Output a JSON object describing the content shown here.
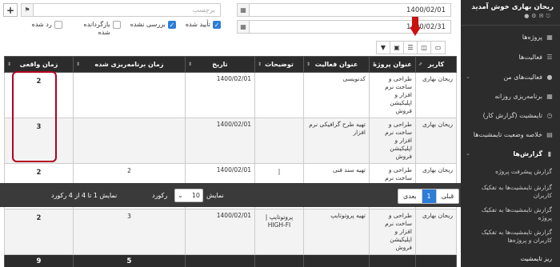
{
  "top": {
    "date_from": "1400/02/01",
    "date_to": "1400/02/31",
    "tag_placeholder": "برچسب"
  },
  "filters": [
    {
      "label": "تأیید شده",
      "checked": true
    },
    {
      "label": "بررسی نشده",
      "checked": true
    },
    {
      "label": "بازگردانده شده",
      "checked": false
    },
    {
      "label": "رد شده",
      "checked": false
    }
  ],
  "table": {
    "headers": [
      "کاربر",
      "عنوان پروژه",
      "عنوان فعالیت",
      "توضیحات",
      "تاریخ",
      "زمان برنامه‌ریزی شده",
      "زمان واقعی"
    ],
    "rows": [
      {
        "user": "ریحان بهاری",
        "project": "طراحی و ساخت نرم افزار و اپلیکیشن فروش",
        "activity": "کدنویسی",
        "desc": "",
        "date": "1400/02/01",
        "planned": "",
        "actual": "2"
      },
      {
        "user": "ریحان بهاری",
        "project": "طراحی و ساخت نرم افزار و اپلیکیشن فروش",
        "activity": "تهیه طرح گرافیکی نرم افزار",
        "desc": "",
        "date": "1400/02/01",
        "planned": "",
        "actual": "3"
      },
      {
        "user": "ریحان بهاری",
        "project": "طراحی و ساخت نرم افزار و اپلیکیشن فروش",
        "activity": "تهیه سند فنی",
        "desc": "|",
        "date": "1400/02/01",
        "planned": "2",
        "actual": "2"
      },
      {
        "user": "ریحان بهاری",
        "project": "طراحی و ساخت نرم افزار و اپلیکیشن فروش",
        "activity": "تهیه پروتوتایپ",
        "desc": "| پروتوتایپ HIGH-FI",
        "date": "1400/02/01",
        "planned": "3",
        "actual": "2"
      }
    ],
    "totals": {
      "planned": "5",
      "actual": "9"
    }
  },
  "footer": {
    "prev": "قبلی",
    "page": "1",
    "next": "بعدی",
    "show_label": "نمایش",
    "page_size": "10",
    "records_label": "رکورد",
    "showing": "نمایش 1 تا 4 از 4 رکورد"
  },
  "sidebar": {
    "welcome": "ریحان بهاری خوش آمدید",
    "items": [
      {
        "label": "پروژه‌ها"
      },
      {
        "label": "فعالیت‌ها"
      },
      {
        "label": "فعالیت‌های من"
      },
      {
        "label": "برنامه‌ریزی روزانه"
      },
      {
        "label": "تایمشیت (گزارش کار)"
      },
      {
        "label": "خلاصه وضعیت تایمشیت‌ها"
      },
      {
        "label": "گزارش‌ها"
      }
    ],
    "subitems": [
      "گزارش پیشرفت پروژه",
      "گزارش تایمشیت‌ها به تفکیک کاربران",
      "گزارش تایمشیت‌ها به تفکیک پروژه",
      "گزارش تایمشیت‌ها به تفکیک کاربران و پروژه‌ها",
      "ریز تایمشیت"
    ]
  }
}
